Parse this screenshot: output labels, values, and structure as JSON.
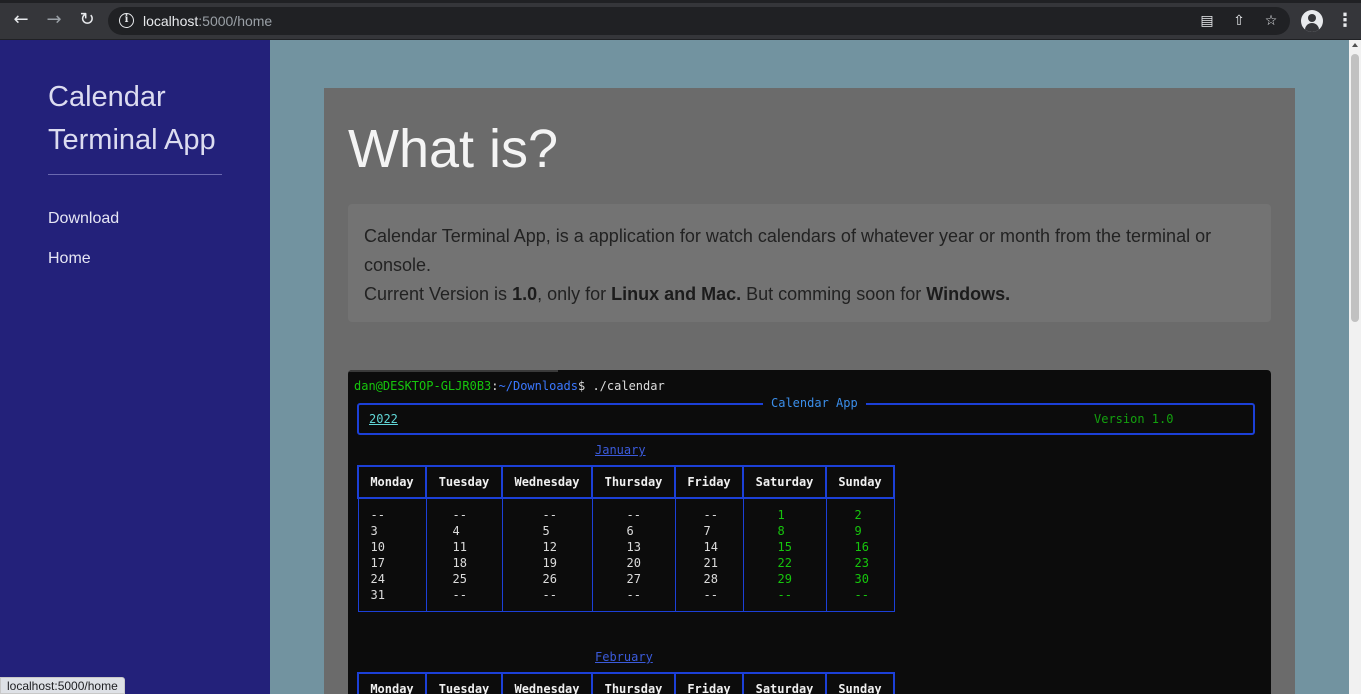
{
  "browser": {
    "url_host": "localhost",
    "url_rest": ":5000/home",
    "icons": [
      "back-icon",
      "forward-icon",
      "reload-icon",
      "info-icon",
      "translate-icon",
      "share-icon",
      "star-icon",
      "profile-icon",
      "menu-icon"
    ],
    "status_url": "localhost:5000/home"
  },
  "sidebar": {
    "brand": "Calendar Terminal App",
    "items": [
      {
        "label": "Download"
      },
      {
        "label": "Home"
      }
    ]
  },
  "main": {
    "title": "What is?",
    "intro_line1": "Calendar Terminal App, is a application for watch calendars of whatever year or month from the terminal or console.",
    "intro_line2_a": "Current Version is ",
    "version": "1.0",
    "intro_line2_b": ", only for ",
    "platforms": "Linux and Mac.",
    "intro_line2_c": " But comming soon for ",
    "soon_platform": "Windows."
  },
  "terminal": {
    "prompt_user": "dan@DESKTOP-GLJR0B3",
    "prompt_sep": ":",
    "prompt_path": "~/Downloads",
    "prompt_cmd": "$ ./calendar",
    "app_title": "Calendar App",
    "year": "2022",
    "version_label": "Version 1.0",
    "weekdays": [
      "Monday",
      "Tuesday",
      "Wednesday",
      "Thursday",
      "Friday",
      "Saturday",
      "Sunday"
    ],
    "months": [
      {
        "name": "January",
        "columns": [
          [
            "--",
            "3",
            "10",
            "17",
            "24",
            "31"
          ],
          [
            "--",
            "4",
            "11",
            "18",
            "25",
            "--"
          ],
          [
            "--",
            "5",
            "12",
            "19",
            "26",
            "--"
          ],
          [
            "--",
            "6",
            "13",
            "20",
            "27",
            "--"
          ],
          [
            "--",
            "7",
            "14",
            "21",
            "28",
            "--"
          ],
          [
            "1",
            "8",
            "15",
            "22",
            "29",
            "--"
          ],
          [
            "2",
            "9",
            "16",
            "23",
            "30",
            "--"
          ]
        ]
      },
      {
        "name": "February"
      }
    ],
    "colors": {
      "weekend": "#16c60c",
      "border": "#1c40d8"
    }
  }
}
